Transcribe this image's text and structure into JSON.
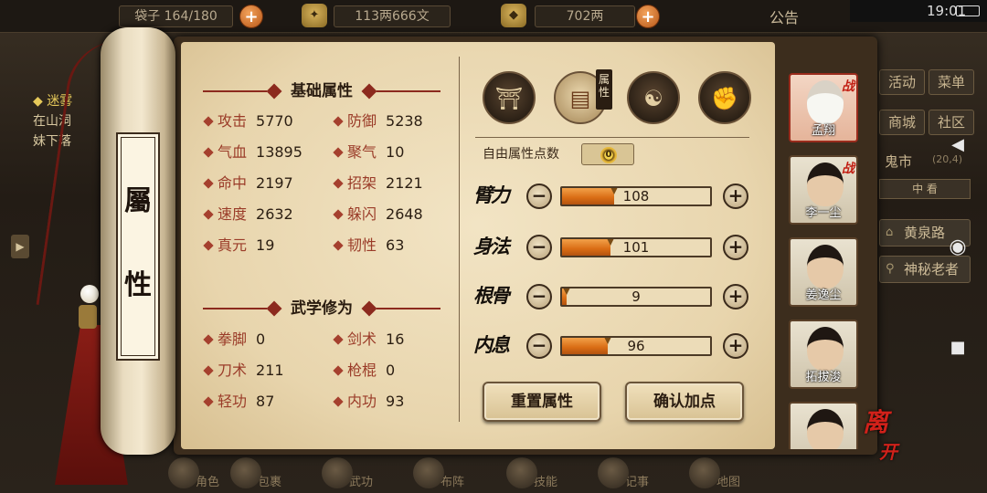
{
  "top": {
    "bag_label": "袋子",
    "bag_count": "164/180",
    "money": "113两666文",
    "gold": "702两",
    "notice": "公告"
  },
  "system": {
    "time": "19:01"
  },
  "left_quest": {
    "title": "迷雾",
    "line1": "在山洞",
    "line2": "妹下落"
  },
  "right_menu": {
    "buttons": [
      "活动",
      "菜单",
      "商城",
      "社区"
    ],
    "location": "鬼市",
    "coords": "(20,4)",
    "mid_label": "中 看",
    "road": "黄泉路",
    "npc": "神秘老者"
  },
  "bottom_nav": [
    "角色",
    "包裹",
    "武功",
    "布阵",
    "技能",
    "记事",
    "地图"
  ],
  "scroll": {
    "char1": "屬",
    "char2": "性"
  },
  "basic": {
    "title": "基础属性",
    "stats": [
      {
        "k": "攻击",
        "v": "5770"
      },
      {
        "k": "防御",
        "v": "5238"
      },
      {
        "k": "气血",
        "v": "13895"
      },
      {
        "k": "聚气",
        "v": "10"
      },
      {
        "k": "命中",
        "v": "2197"
      },
      {
        "k": "招架",
        "v": "2121"
      },
      {
        "k": "速度",
        "v": "2632"
      },
      {
        "k": "躲闪",
        "v": "2648"
      },
      {
        "k": "真元",
        "v": "19"
      },
      {
        "k": "韧性",
        "v": "63"
      }
    ]
  },
  "martial": {
    "title": "武学修为",
    "stats": [
      {
        "k": "拳脚",
        "v": "0"
      },
      {
        "k": "剑术",
        "v": "16"
      },
      {
        "k": "刀术",
        "v": "211"
      },
      {
        "k": "枪棍",
        "v": "0"
      },
      {
        "k": "轻功",
        "v": "87"
      },
      {
        "k": "内功",
        "v": "93"
      }
    ]
  },
  "tabs": {
    "attr_tab": "属性",
    "icons": [
      "straw-hat-warrior-icon",
      "scroll-map-icon",
      "yin-yang-icon",
      "muscle-figure-icon"
    ]
  },
  "free_points": {
    "label": "自由属性点数",
    "value": "0"
  },
  "attributes": [
    {
      "name": "臂力",
      "value": 108,
      "fill": 0.35
    },
    {
      "name": "身法",
      "value": 101,
      "fill": 0.33
    },
    {
      "name": "根骨",
      "value": 9,
      "fill": 0.03
    },
    {
      "name": "内息",
      "value": 96,
      "fill": 0.31
    }
  ],
  "buttons": {
    "reset": "重置属性",
    "confirm": "确认加点"
  },
  "portraits": [
    {
      "name": "孟翔",
      "battle": "战"
    },
    {
      "name": "李一尘",
      "battle": "战"
    },
    {
      "name": "姜逸尘",
      "battle": ""
    },
    {
      "name": "拓拔浚",
      "battle": ""
    }
  ],
  "leave": {
    "char1": "离",
    "char2": "开"
  },
  "colors": {
    "accent": "#9a3b28",
    "bar_fill": "#d96c14",
    "paper": "#f2e4c4"
  }
}
